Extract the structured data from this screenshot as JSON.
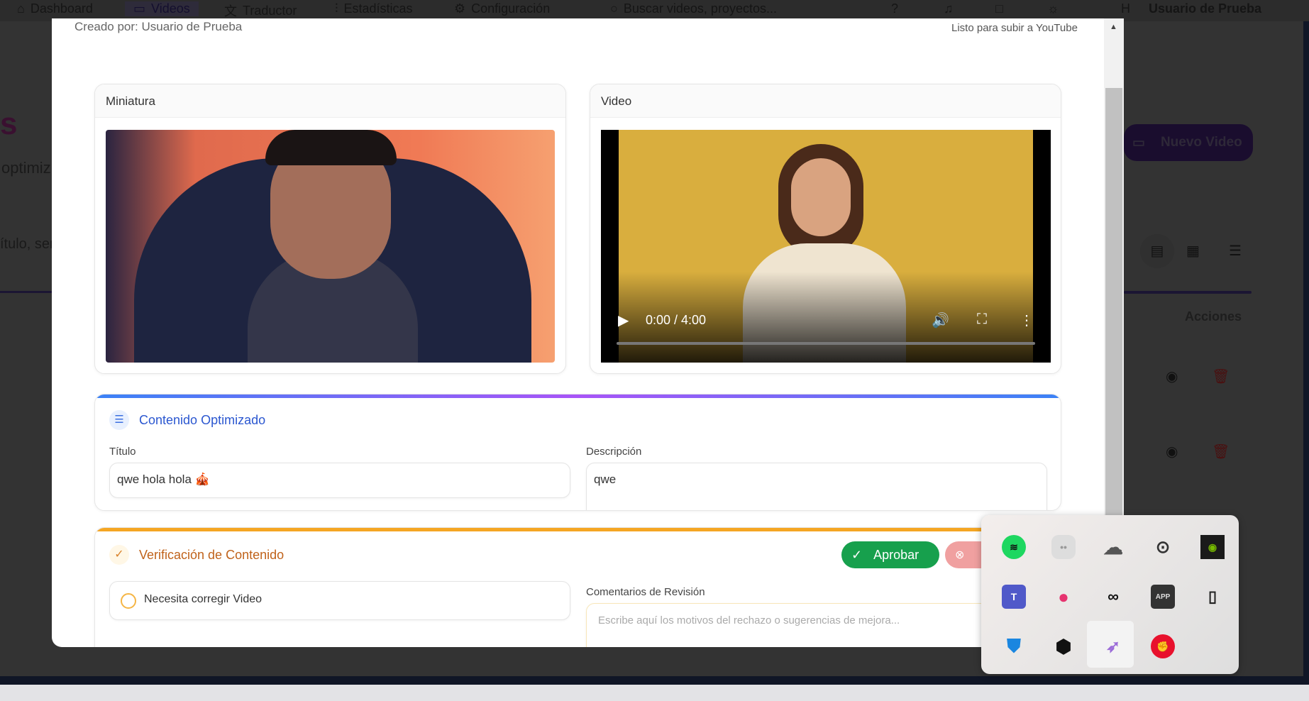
{
  "nav": {
    "items": [
      {
        "label": "Dashboard",
        "icon": "home-icon"
      },
      {
        "label": "Videos",
        "icon": "video-icon"
      },
      {
        "label": "Traductor",
        "icon": "translate-icon"
      },
      {
        "label": "Estadísticas",
        "icon": "bar-chart-icon"
      },
      {
        "label": "Configuración",
        "icon": "gear-icon"
      }
    ],
    "search_placeholder": "Buscar videos, proyectos...",
    "avatar_initial": "H",
    "user": "Usuario de Prueba"
  },
  "background": {
    "title_fragment": "s",
    "subtitle_fragment": "optimiz",
    "search_fragment": "ítulo, ser",
    "new_video": "Nuevo Video",
    "actions_header": "Acciones"
  },
  "modal": {
    "created_by": "Creado por: Usuario de Prueba",
    "status": "Listo para subir a YouTube",
    "thumbnail_title": "Miniatura",
    "video_title": "Video",
    "video_time": "0:00 / 4:00",
    "video_progress": 0,
    "optimized": {
      "title": "Contenido Optimizado",
      "title_label": "Título",
      "title_value": "qwe hola hola 🎪",
      "desc_label": "Descripción",
      "desc_value": "qwe"
    },
    "verification": {
      "title": "Verificación de Contenido",
      "approve": "Aprobar",
      "option": "Necesita corregir Video",
      "comments_label": "Comentarios de Revisión",
      "comments_placeholder": "Escribe aquí los motivos del rechazo o sugerencias de mejora..."
    }
  },
  "tray": {
    "icons": [
      "spotify-icon",
      "discord-icon",
      "onedrive-icon",
      "steelseries-icon",
      "nvidia-icon",
      "teams-icon",
      "slack-icon",
      "creative-cloud-icon",
      "app-icon",
      "usb-eject-icon",
      "defender-warning-icon",
      "icue-icon",
      "feather-icon",
      "riot-icon"
    ],
    "app_label": "APP"
  }
}
